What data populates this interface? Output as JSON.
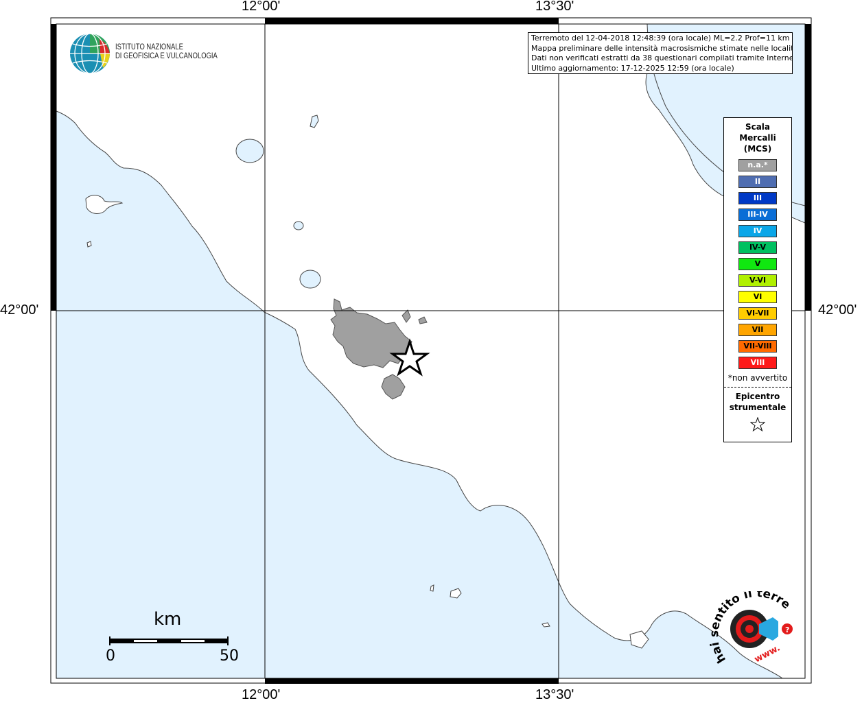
{
  "institute": {
    "name_line1": "ISTITUTO NAZIONALE",
    "name_line2": "DI GEOFISICA E VULCANOLOGIA"
  },
  "info": {
    "line1": "Terremoto del 12-04-2018 12:48:39 (ora locale) ML=2.2 Prof=11 km",
    "line2": "Mappa preliminare delle intensità macrosismiche stimate nelle località",
    "line3": "Dati non verificati estratti da 38 questionari compilati tramite Internet.",
    "line4": "Ultimo aggiornamento: 17-12-2025 12:59 (ora locale)"
  },
  "coords": {
    "top_left": "12°00'",
    "top_right": "13°30'",
    "bottom_left": "12°00'",
    "bottom_right": "13°30'",
    "left_lat": "42°00'",
    "right_lat": "42°00'"
  },
  "legend": {
    "title1": "Scala",
    "title2": "Mercalli",
    "title3": "(MCS)",
    "items": [
      {
        "label": "n.a.*",
        "color": "#a0a0a0",
        "text_color": "#ffffff"
      },
      {
        "label": "II",
        "color": "#4f6db1",
        "text_color": "#ffffff"
      },
      {
        "label": "III",
        "color": "#0039c6",
        "text_color": "#ffffff"
      },
      {
        "label": "III-IV",
        "color": "#0a6ed6",
        "text_color": "#ffffff"
      },
      {
        "label": "IV",
        "color": "#0aa6e8",
        "text_color": "#ffffff"
      },
      {
        "label": "IV-V",
        "color": "#00c060",
        "text_color": "#000000"
      },
      {
        "label": "V",
        "color": "#10e810",
        "text_color": "#000000"
      },
      {
        "label": "V-VI",
        "color": "#b0f000",
        "text_color": "#000000"
      },
      {
        "label": "VI",
        "color": "#ffff00",
        "text_color": "#000000"
      },
      {
        "label": "VI-VII",
        "color": "#ffcc00",
        "text_color": "#000000"
      },
      {
        "label": "VII",
        "color": "#ffa500",
        "text_color": "#000000"
      },
      {
        "label": "VII-VIII",
        "color": "#ff6a00",
        "text_color": "#000000"
      },
      {
        "label": "VIII",
        "color": "#ff1a1a",
        "text_color": "#ffffff"
      }
    ],
    "note": "*non avvertito",
    "epicenter_title1": "Epicentro",
    "epicenter_title2": "strumentale"
  },
  "scalebar": {
    "unit": "km",
    "min": "0",
    "max": "50"
  },
  "hsit": {
    "brand": "hai sentito il terremoto.it",
    "url": "www."
  },
  "colors": {
    "sea": "#e1f2fe",
    "land": "#ffffff",
    "affected": "#a0a0a0"
  }
}
